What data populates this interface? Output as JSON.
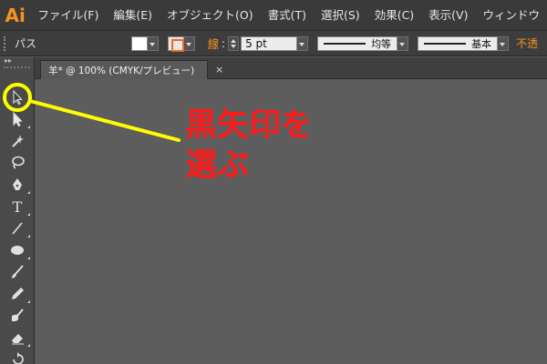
{
  "app": {
    "logo": "Ai"
  },
  "menu": {
    "items": [
      "ファイル(F)",
      "編集(E)",
      "オブジェクト(O)",
      "書式(T)",
      "選択(S)",
      "効果(C)",
      "表示(V)",
      "ウィンドウ"
    ]
  },
  "control_bar": {
    "selection_label": "パス",
    "stroke_label": "線",
    "colon": ":",
    "stroke_weight": "5 pt",
    "profile_label": "均等",
    "brush_label": "基本",
    "opacity_label": "不透"
  },
  "document": {
    "tab_title": "羊* @ 100% (CMYK/プレビュー)",
    "close_glyph": "×"
  },
  "tools": {
    "header": "▸▸",
    "items": [
      {
        "name": "selection-tool",
        "icon": "black-arrow-icon"
      },
      {
        "name": "direct-selection-tool",
        "icon": "white-arrow-icon"
      },
      {
        "name": "magic-wand-tool",
        "icon": "magic-wand-icon"
      },
      {
        "name": "lasso-tool",
        "icon": "lasso-icon"
      },
      {
        "name": "pen-tool",
        "icon": "pen-icon"
      },
      {
        "name": "type-tool",
        "icon": "type-icon",
        "glyph": "T"
      },
      {
        "name": "line-tool",
        "icon": "line-icon"
      },
      {
        "name": "ellipse-tool",
        "icon": "ellipse-icon"
      },
      {
        "name": "paintbrush-tool",
        "icon": "paintbrush-icon"
      },
      {
        "name": "pencil-tool",
        "icon": "pencil-icon"
      },
      {
        "name": "blob-brush-tool",
        "icon": "blob-brush-icon"
      },
      {
        "name": "eraser-tool",
        "icon": "eraser-icon"
      },
      {
        "name": "rotate-tool",
        "icon": "rotate-icon"
      }
    ]
  },
  "annotation": {
    "text": "黒矢印を\n選ぶ",
    "color": "#ff1a1a",
    "highlight_color": "#ffff00"
  },
  "colors": {
    "accent": "#f7931e",
    "canvas": "#5d5d5d",
    "panel": "#4a4a4a"
  }
}
